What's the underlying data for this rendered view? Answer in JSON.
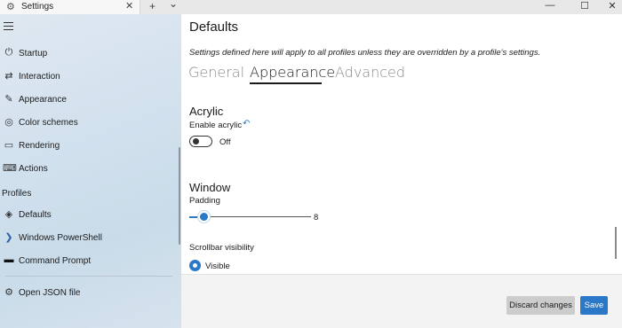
{
  "titlebar": {
    "tab_label": "Settings",
    "tab_icon": "gear-icon",
    "close_glyph": "✕",
    "new_tab_glyph": "+",
    "dropdown_glyph": "⌄",
    "minimize_glyph": "—",
    "maximize_glyph": "☐",
    "window_close_glyph": "✕"
  },
  "sidebar": {
    "items": [
      {
        "label": "Startup",
        "icon": "startup-icon",
        "glyph": "⏻"
      },
      {
        "label": "Interaction",
        "icon": "interaction-icon",
        "glyph": "⇄"
      },
      {
        "label": "Appearance",
        "icon": "brush-icon",
        "glyph": "✎"
      },
      {
        "label": "Color schemes",
        "icon": "palette-icon",
        "glyph": "◎"
      },
      {
        "label": "Rendering",
        "icon": "monitor-icon",
        "glyph": "▭"
      },
      {
        "label": "Actions",
        "icon": "keyboard-icon",
        "glyph": "⌨"
      }
    ],
    "profiles_header": "Profiles",
    "profiles": [
      {
        "label": "Defaults",
        "icon": "layers-icon",
        "glyph": "◈"
      },
      {
        "label": "Windows PowerShell",
        "icon": "powershell-icon",
        "glyph": "❯"
      },
      {
        "label": "Command Prompt",
        "icon": "terminal-icon",
        "glyph": "▬"
      }
    ],
    "open_json": {
      "label": "Open JSON file",
      "icon": "gear-icon",
      "glyph": "⚙"
    }
  },
  "main": {
    "title": "Defaults",
    "subtitle": "Settings defined here will apply to all profiles unless they are overridden by a profile's settings.",
    "tabs": [
      {
        "label": "General"
      },
      {
        "label": "Appearance"
      },
      {
        "label": "Advanced"
      }
    ],
    "active_tab": "Appearance",
    "acrylic": {
      "title": "Acrylic",
      "toggle_label": "Enable acrylic",
      "toggle_state": "Off"
    },
    "window": {
      "title": "Window",
      "padding_label": "Padding",
      "padding_value": "8",
      "scrollbar_label": "Scrollbar visibility",
      "scrollbar_selected": "Visible"
    }
  },
  "footer": {
    "discard_label": "Discard changes",
    "save_label": "Save"
  },
  "colors": {
    "accent": "#2a78c7"
  }
}
